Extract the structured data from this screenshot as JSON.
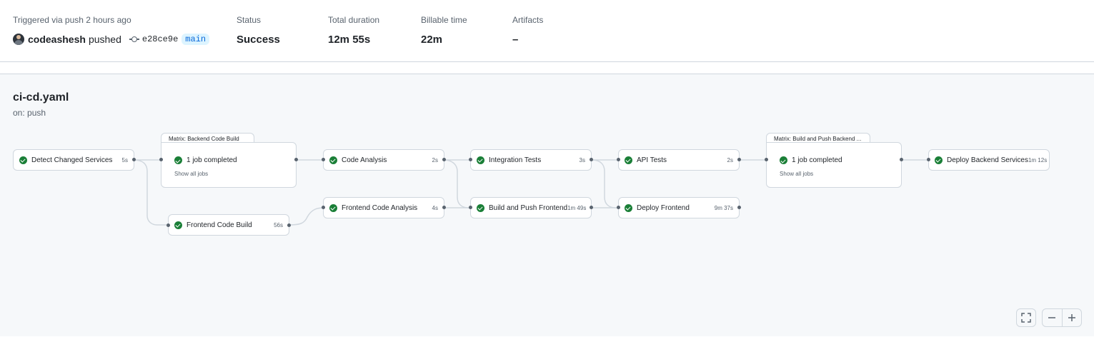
{
  "summary": {
    "trigger_label": "Triggered via push 2 hours ago",
    "actor": "codeashesh",
    "action": "pushed",
    "commit_sha": "e28ce9e",
    "branch": "main",
    "status_label": "Status",
    "status_value": "Success",
    "duration_label": "Total duration",
    "duration_value": "12m 55s",
    "billable_label": "Billable time",
    "billable_value": "22m",
    "artifacts_label": "Artifacts",
    "artifacts_value": "–"
  },
  "workflow": {
    "file": "ci-cd.yaml",
    "trigger": "on: push"
  },
  "jobs": {
    "detect": {
      "name": "Detect Changed Services",
      "duration": "5s"
    },
    "matrix_backend": {
      "tab": "Matrix: Backend Code Build",
      "status": "1 job completed",
      "link": "Show all jobs"
    },
    "frontend_build": {
      "name": "Frontend Code Build",
      "duration": "56s"
    },
    "code_analysis": {
      "name": "Code Analysis",
      "duration": "2s"
    },
    "frontend_analysis": {
      "name": "Frontend Code Analysis",
      "duration": "4s"
    },
    "integration": {
      "name": "Integration Tests",
      "duration": "3s"
    },
    "build_push_frontend": {
      "name": "Build and Push Frontend",
      "duration": "1m 49s"
    },
    "api_tests": {
      "name": "API Tests",
      "duration": "2s"
    },
    "deploy_frontend": {
      "name": "Deploy Frontend",
      "duration": "9m 37s"
    },
    "matrix_push_backend": {
      "tab": "Matrix: Build and Push Backend ...",
      "status": "1 job completed",
      "link": "Show all jobs"
    },
    "deploy_backend": {
      "name": "Deploy Backend Services",
      "duration": "1m 12s"
    }
  },
  "colors": {
    "success": "#1a7f37",
    "branch_bg": "#ddf4ff",
    "branch_fg": "#0969da"
  },
  "controls": {
    "fullscreen_icon": "fullscreen-icon",
    "zoom_out_icon": "zoom-out-icon",
    "zoom_in_icon": "zoom-in-icon"
  }
}
